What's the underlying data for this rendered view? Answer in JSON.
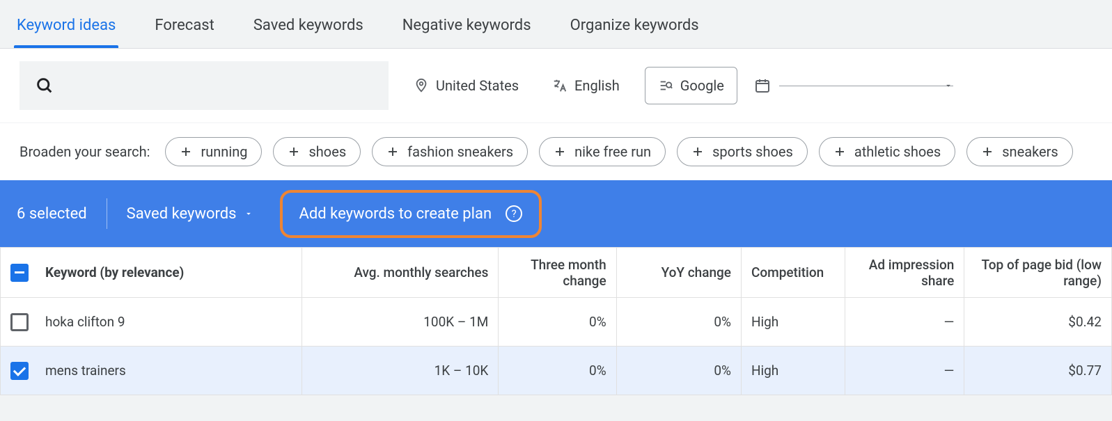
{
  "tabs": [
    "Keyword ideas",
    "Forecast",
    "Saved keywords",
    "Negative keywords",
    "Organize keywords"
  ],
  "filters": {
    "location": "United States",
    "language": "English",
    "network": "Google"
  },
  "broaden": {
    "label": "Broaden your search:",
    "chips": [
      "running",
      "shoes",
      "fashion sneakers",
      "nike free run",
      "sports shoes",
      "athletic shoes",
      "sneakers"
    ]
  },
  "selection_bar": {
    "count_label": "6 selected",
    "saved_label": "Saved keywords",
    "add_label": "Add keywords to create plan"
  },
  "columns": {
    "keyword": "Keyword (by relevance)",
    "avg": "Avg. monthly searches",
    "three": "Three month change",
    "yoy": "YoY change",
    "comp": "Competition",
    "impr": "Ad impression share",
    "bid": "Top of page bid (low range)"
  },
  "rows": [
    {
      "checked": false,
      "keyword": "hoka clifton 9",
      "avg": "100K – 1M",
      "three": "0%",
      "yoy": "0%",
      "comp": "High",
      "impr": "—",
      "bid": "$0.42"
    },
    {
      "checked": true,
      "keyword": "mens trainers",
      "avg": "1K – 10K",
      "three": "0%",
      "yoy": "0%",
      "comp": "High",
      "impr": "—",
      "bid": "$0.77"
    }
  ]
}
